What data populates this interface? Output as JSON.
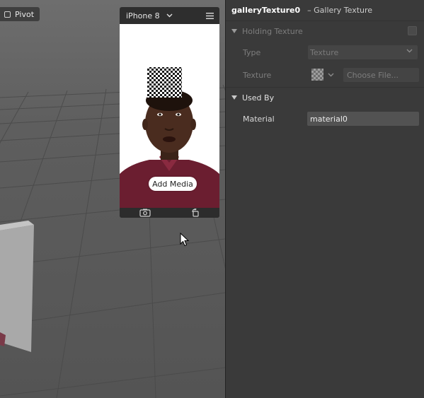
{
  "viewport": {
    "pivot_label": "Pivot",
    "simulator": {
      "device_name": "iPhone 8",
      "add_media_label": "Add Media"
    }
  },
  "inspector": {
    "title": "galleryTexture0",
    "subtitle": "– Gallery Texture",
    "holding_texture": {
      "section_label": "Holding Texture",
      "checked": false,
      "type_label": "Type",
      "type_value": "Texture",
      "texture_label": "Texture",
      "choose_file_label": "Choose File..."
    },
    "used_by": {
      "section_label": "Used By",
      "material_label": "Material",
      "material_value": "material0"
    }
  },
  "colors": {
    "panel_bg": "#3a3a3a",
    "disabled_text": "#7d7d7d",
    "field_bg": "#525252"
  }
}
